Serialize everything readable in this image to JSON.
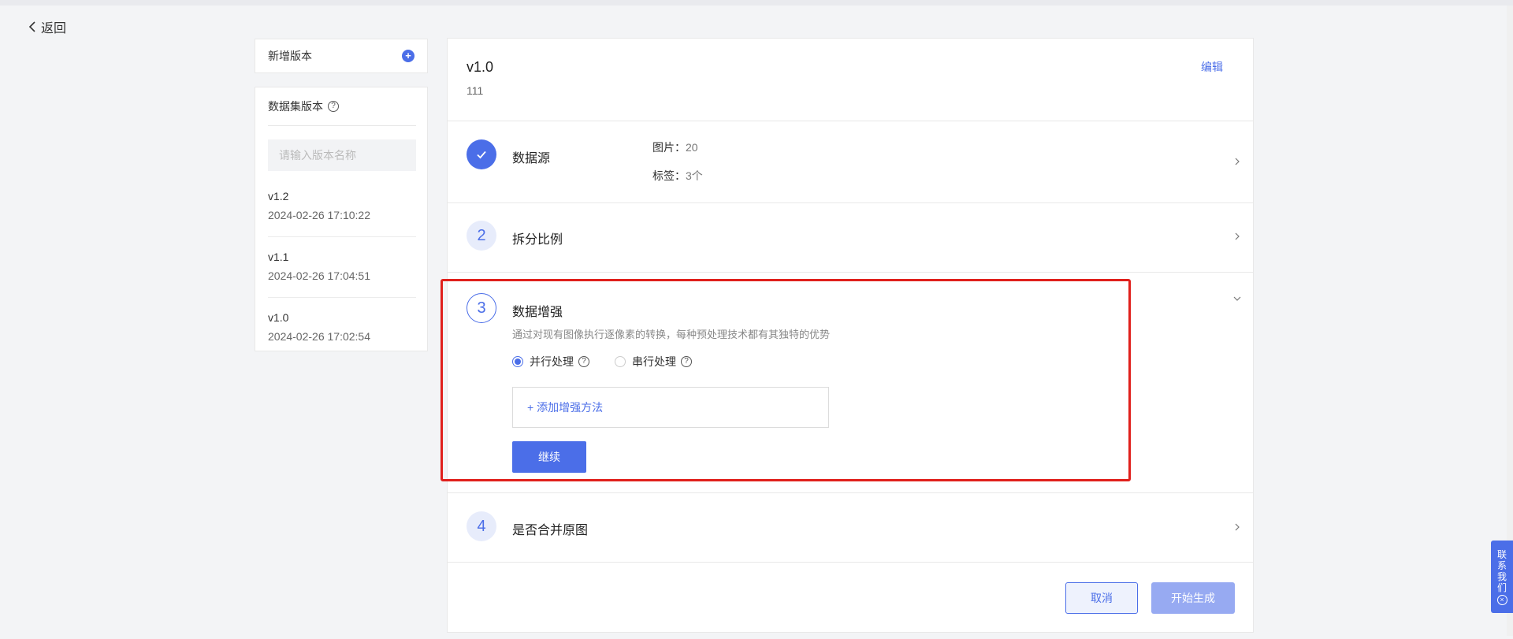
{
  "nav": {
    "back_label": "返回"
  },
  "sidebar": {
    "add_version_label": "新增版本",
    "panel_title": "数据集版本",
    "search_placeholder": "请输入版本名称",
    "versions": [
      {
        "name": "v1.2",
        "date": "2024-02-26 17:10:22"
      },
      {
        "name": "v1.1",
        "date": "2024-02-26 17:04:51"
      },
      {
        "name": "v1.0",
        "date": "2024-02-26 17:02:54"
      }
    ]
  },
  "main": {
    "version_title": "v1.0",
    "version_desc": "111",
    "edit_label": "编辑",
    "steps": [
      {
        "number": "",
        "title": "数据源",
        "status": "done"
      },
      {
        "number": "2",
        "title": "拆分比例",
        "status": "idle"
      },
      {
        "number": "3",
        "title": "数据增强",
        "status": "active"
      },
      {
        "number": "4",
        "title": "是否合并原图",
        "status": "idle"
      }
    ],
    "datasource": {
      "images_label": "图片：",
      "images_value": "20",
      "tags_label": "标签：",
      "tags_value": "3个"
    },
    "augmentation": {
      "description": "通过对现有图像执行逐像素的转换，每种预处理技术都有其独特的优势",
      "options": [
        {
          "label": "并行处理",
          "selected": true
        },
        {
          "label": "串行处理",
          "selected": false
        }
      ],
      "add_method_label": "+ 添加增强方法",
      "continue_label": "继续"
    },
    "cancel_label": "取消",
    "start_label": "开始生成"
  },
  "contact": {
    "chars": [
      "联",
      "系",
      "我",
      "们"
    ]
  },
  "colors": {
    "accent": "#4b6ee8",
    "highlight": "#e0201c",
    "accent_light": "#97aaf2"
  }
}
